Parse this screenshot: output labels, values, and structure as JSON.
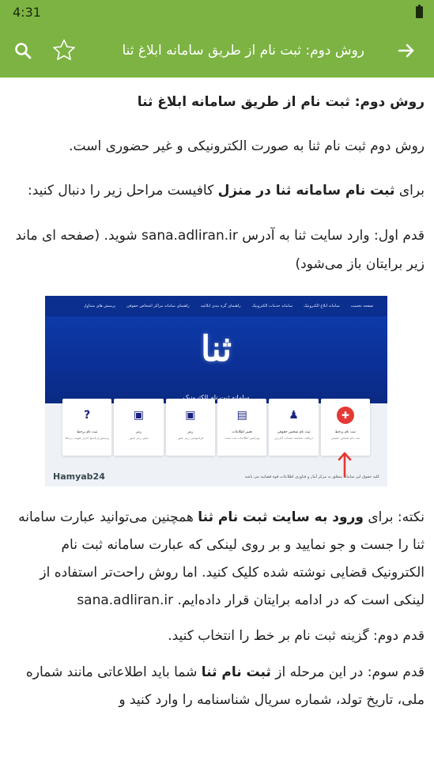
{
  "status_bar": {
    "time": "4:31"
  },
  "app_bar": {
    "title": "روش دوم: ثبت نام از طریق سامانه ابلاغ ثنا"
  },
  "article": {
    "heading": "روش دوم: ثبت نام از طریق سامانه ابلاغ ثنا",
    "p1": "روش دوم ثبت نام ثنا به صورت الکترونیکی و غیر حضوری است.",
    "p2_pre": "برای ",
    "p2_bold": "ثبت نام سامانه ثنا در منزل",
    "p2_post": " کافیست مراحل زیر را دنبال کنید:",
    "p3_pre": "قدم اول: وارد سایت ثنا به آدرس ",
    "p3_url": "sana.adliran.ir",
    "p3_post": " شوید. (صفحه ای ماند زیر برایتان باز می‌شود)",
    "note_pre": "نکته: برای ",
    "note_bold": "ورود به سایت ثبت نام ثنا",
    "note_post": " همچنین می‌توانید عبارت سامانه ثنا را جست و جو نمایید و بر روی لینکی که عبارت سامانه ثبت نام الکترونیک قضایی نوشته شده کلیک کنید. اما روش راحت‌تر استفاده از لینکی است که در ادامه برایتان قرار داده‌ایم. ",
    "note_url": "sana.adliran.ir",
    "step2": "قدم دوم: گزینه ثبت نام بر خط را انتخاب کنید.",
    "step3_pre": "قدم سوم: در این مرحله از ",
    "step3_bold": "ثبت نام ثنا",
    "step3_post": " شما باید اطلاعاتی مانند شماره ملی، تاریخ تولد، شماره سریال شناسنامه را وارد کنید و"
  },
  "figure": {
    "nav": [
      "صفحه نخست",
      "سامانه ابلاغ الکترونیک",
      "سامانه خدمات الکترونیک",
      "راهنمای گره بندی ابلاغیه",
      "راهنمای سامانه مراکز اشخاص حقوقی",
      "پرسش های متداول"
    ],
    "logo_glyph": "ثنا",
    "logo_subtitle": "سامانه ثبت نام الکترونیک",
    "cards": [
      {
        "label": "ثبت نام برخط",
        "sub": "ثبت نام شخص حقیقی"
      },
      {
        "label": "ثبت نام شخص حقوقی",
        "sub": "دریافت شناسه حساب کاربری"
      },
      {
        "label": "تغییر اطلاعات",
        "sub": "ویرایش اطلاعات ثبت شده"
      },
      {
        "label": "رمز",
        "sub": "فراموشی رمز عبور"
      },
      {
        "label": "رمز",
        "sub": "تغییر رمز عبور"
      },
      {
        "label": "ثبت نام برخط",
        "sub": "پرسش و پاسخ احراز هویت برخط"
      }
    ],
    "card_icons": [
      "person-add",
      "person-add",
      "form",
      "lock",
      "lock",
      "?"
    ],
    "watermark": "Hamyab24",
    "copyright": "کلیه حقوق این سامانه متعلق به مرکز آمار و فناوری اطلاعات قوه قضاییه می باشد"
  }
}
